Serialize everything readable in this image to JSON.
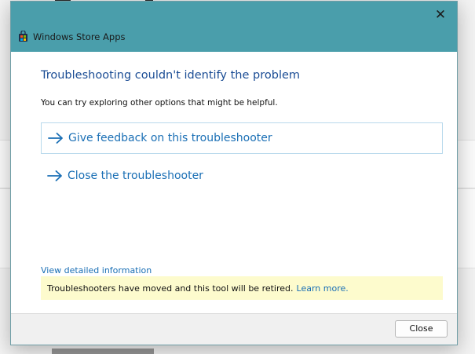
{
  "window": {
    "title": "Windows Store Apps",
    "close_glyph": "✕"
  },
  "content": {
    "heading": "Troubleshooting couldn't identify the problem",
    "subtext": "You can try exploring other options that might be helpful.",
    "options": [
      {
        "label": "Give feedback on this troubleshooter",
        "icon": "arrow-right-icon"
      },
      {
        "label": "Close the troubleshooter",
        "icon": "arrow-right-icon"
      }
    ],
    "details_link": "View detailed information",
    "notice": {
      "text": "Troubleshooters have moved and this tool will be retired.",
      "link": "Learn more."
    }
  },
  "footer": {
    "close_label": "Close"
  },
  "colors": {
    "titlebar": "#4a9eab",
    "heading": "#1b4d95",
    "link": "#1a6fb5",
    "notice_bg": "#fdfbcd"
  }
}
